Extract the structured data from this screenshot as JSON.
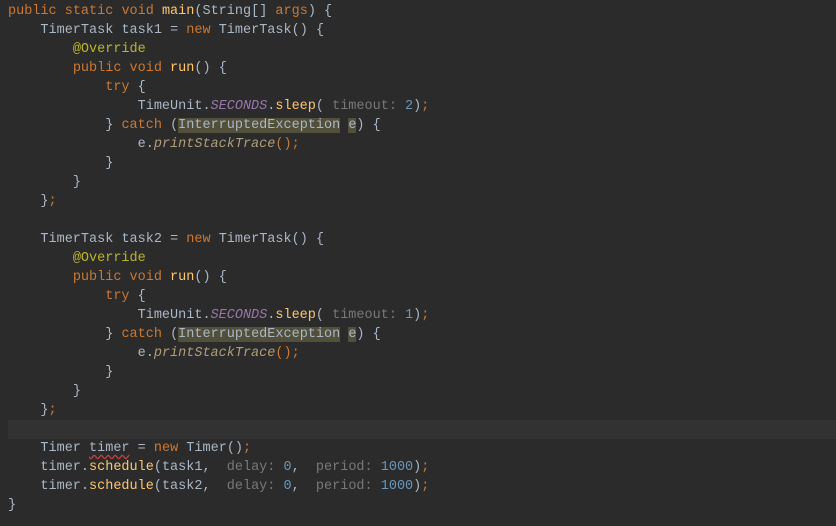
{
  "tokens": {
    "public": "public",
    "static": "static",
    "void": "void",
    "main": "main",
    "String": "String",
    "args": "args",
    "TimerTask": "TimerTask",
    "task1": "task1",
    "task2": "task2",
    "new": "new",
    "Override": "@Override",
    "run": "run",
    "try": "try",
    "catch": "catch",
    "TimeUnit": "TimeUnit",
    "SECONDS": "SECONDS",
    "sleep": "sleep",
    "timeout": "timeout:",
    "two": "2",
    "one": "1",
    "InterruptedException": "InterruptedException",
    "e": "e",
    "printStackTrace": "printStackTrace",
    "Timer": "Timer",
    "timer": "timer",
    "schedule": "schedule",
    "delay": "delay:",
    "zero": "0",
    "period": "period:",
    "thousand": "1000"
  },
  "punct": {
    "lparen": "(",
    "rparen": ")",
    "lbrace": "{",
    "rbrace": "}",
    "lbracket": "[",
    "rbracket": "]",
    "semi": ";",
    "comma": ",",
    "dot": ".",
    "eq": "="
  }
}
